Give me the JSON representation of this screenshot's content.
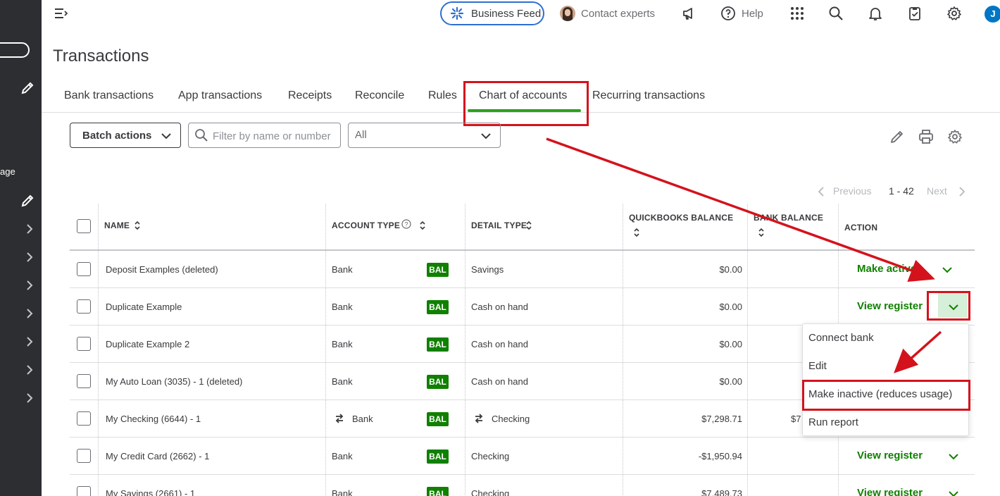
{
  "sidebar": {
    "partial_label": "age"
  },
  "topbar": {
    "business_feed": "Business Feed",
    "contact_experts": "Contact experts",
    "help": "Help",
    "user_initial": "J"
  },
  "page": {
    "title": "Transactions"
  },
  "tabs": [
    {
      "label": "Bank transactions"
    },
    {
      "label": "App transactions"
    },
    {
      "label": "Receipts"
    },
    {
      "label": "Reconcile"
    },
    {
      "label": "Rules"
    },
    {
      "label": "Chart of accounts",
      "active": true
    },
    {
      "label": "Recurring transactions"
    }
  ],
  "toolbar": {
    "batch_actions": "Batch actions",
    "search_placeholder": "Filter by name or number",
    "filter_value": "All"
  },
  "pagination": {
    "previous": "Previous",
    "range": "1 - 42",
    "next": "Next"
  },
  "table": {
    "headers": {
      "name": "NAME",
      "account_type": "ACCOUNT TYPE",
      "detail_type": "DETAIL TYPE",
      "qb_balance": "QUICKBOOKS BALANCE",
      "bank_balance": "BANK BALANCE",
      "action": "ACTION"
    },
    "rows": [
      {
        "name": "Deposit Examples (deleted)",
        "account_type": "Bank",
        "badge": "BAL",
        "detail_type": "Savings",
        "qb_balance": "$0.00",
        "bank_balance": "",
        "action": "Make active"
      },
      {
        "name": "Duplicate Example",
        "account_type": "Bank",
        "badge": "BAL",
        "detail_type": "Cash on hand",
        "qb_balance": "$0.00",
        "bank_balance": "",
        "action": "View register"
      },
      {
        "name": "Duplicate Example 2",
        "account_type": "Bank",
        "badge": "BAL",
        "detail_type": "Cash on hand",
        "qb_balance": "$0.00",
        "bank_balance": "",
        "action": ""
      },
      {
        "name": "My Auto Loan (3035) - 1 (deleted)",
        "account_type": "Bank",
        "badge": "BAL",
        "detail_type": "Cash on hand",
        "qb_balance": "$0.00",
        "bank_balance": "",
        "action": ""
      },
      {
        "name": "My Checking (6644) - 1",
        "account_type": "Bank",
        "badge": "BAL",
        "detail_type": "Checking",
        "qb_balance": "$7,298.71",
        "bank_balance": "$7",
        "action": ""
      },
      {
        "name": "My Credit Card (2662) - 1",
        "account_type": "Bank",
        "badge": "BAL",
        "detail_type": "Checking",
        "qb_balance": "-$1,950.94",
        "bank_balance": "",
        "action": "View register"
      },
      {
        "name": "My Savings (2661) - 1",
        "account_type": "Bank",
        "badge": "BAL",
        "detail_type": "Checking",
        "qb_balance": "$7,489.73",
        "bank_balance": "",
        "action": "View register"
      }
    ]
  },
  "dropdown_menu": {
    "items": [
      "Connect bank",
      "Edit",
      "Make inactive (reduces usage)",
      "Run report"
    ]
  },
  "colors": {
    "accent_green": "#108000",
    "annotation_red": "#d4121c",
    "focus_blue": "#2d6fd1"
  }
}
